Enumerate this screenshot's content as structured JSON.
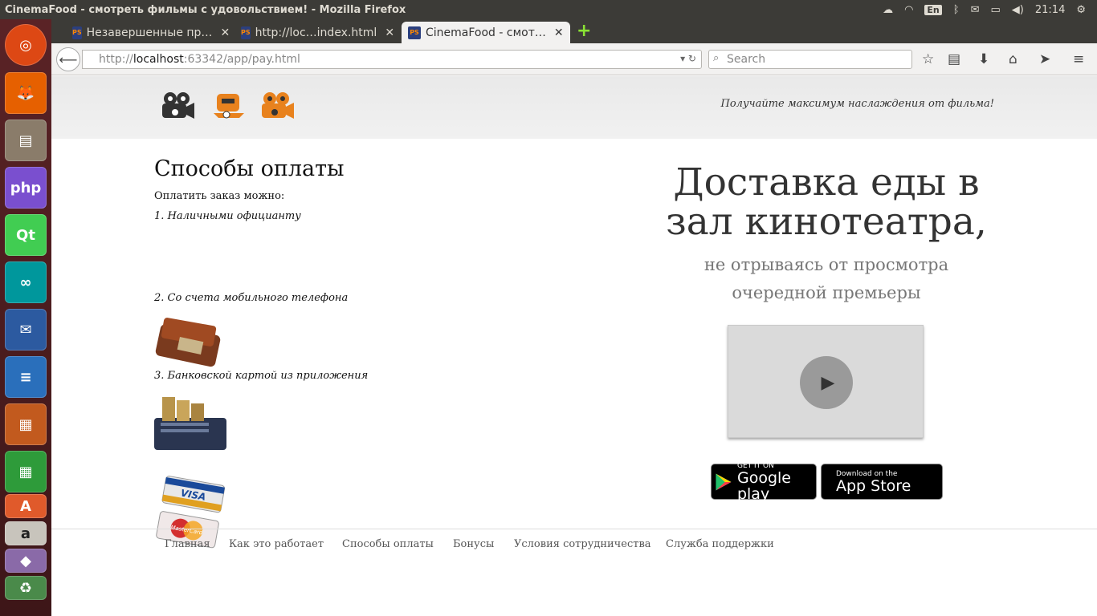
{
  "window": {
    "title": "CinemaFood - смотреть фильмы с удовольствием! - Mozilla Firefox",
    "keyboard_layout": "En",
    "clock": "21:14"
  },
  "launcher": {
    "items": [
      "ubuntu-logo-icon",
      "firefox-icon",
      "files-icon",
      "phpstorm-icon",
      "qt-creator-icon",
      "arduino-icon",
      "thunderbird-icon",
      "writer-icon",
      "impress-icon",
      "calc-icon",
      "software-center-icon",
      "amazon-icon",
      "trash-icon"
    ]
  },
  "tabs": [
    {
      "label": "Незавершенные пр…"
    },
    {
      "label": "http://loc…index.html"
    },
    {
      "label": "CinemaFood - смот…"
    }
  ],
  "navbar": {
    "url_prefix": "http://",
    "url_host": "localhost",
    "url_rest": ":63342/app/pay.html",
    "search_placeholder": "Search"
  },
  "site": {
    "tagline": "Получайте максимум наслаждения от фильма!",
    "colors": {
      "logo_dark": "#333333",
      "logo_orange": "#e8821e"
    }
  },
  "payment": {
    "title": "Способы оплаты",
    "intro": "Оплатить заказ можно:",
    "methods": [
      {
        "label": "1. Наличными официанту",
        "image": "wallet-image"
      },
      {
        "label": "2. Со счета мобильного телефона",
        "image": "phone-coins-image"
      },
      {
        "label": "3. Банковской картой из приложения",
        "image": "cards-image"
      }
    ],
    "card_brands": [
      "VISA",
      "MasterCard"
    ]
  },
  "promo": {
    "headline_1": "Доставка еды в",
    "headline_2": "зал кинотеатра,",
    "sub_1": "не отрываясь от просмотра",
    "sub_2": "очередной премьеры"
  },
  "stores": {
    "google_small": "GET IT ON",
    "google_large": "Google play",
    "apple_small": "Download on the",
    "apple_large": "App Store"
  },
  "footer": {
    "links": [
      "Главная",
      "Как это работает",
      "Способы оплаты",
      "Бонусы",
      "Условия сотрудничества",
      "Служба поддержки"
    ]
  }
}
